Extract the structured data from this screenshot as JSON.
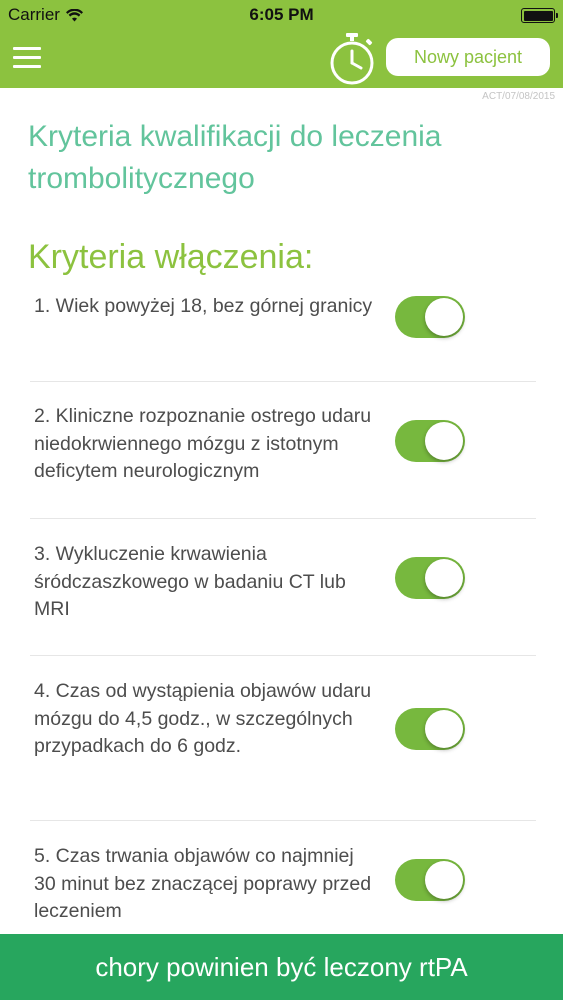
{
  "status_bar": {
    "carrier": "Carrier",
    "time": "6:05 PM",
    "icons": [
      "wifi-icon",
      "battery-icon"
    ]
  },
  "nav": {
    "menu_icon": "hamburger-menu-icon",
    "timer_icon": "stopwatch-icon",
    "new_patient_label": "Nowy pacjent"
  },
  "version_label": "ACT/07/08/2015",
  "page_title": "Kryteria kwalifikacji do leczenia trombolitycznego",
  "section_title": "Kryteria włączenia:",
  "criteria": [
    {
      "text": "1. Wiek powyżej 18, bez górnej granicy",
      "enabled": true
    },
    {
      "text": "2. Kliniczne rozpoznanie ostrego udaru niedokrwiennego mózgu z istotnym deficytem neurologicznym",
      "enabled": true
    },
    {
      "text": "3. Wykluczenie krwawienia śródczaszkowego w badaniu CT lub MRI",
      "enabled": true
    },
    {
      "text": "4. Czas od wystąpienia objawów udaru mózgu do 4,5 godz., w szczególnych przypadkach do 6 godz.",
      "enabled": true
    },
    {
      "text": "5. Czas trwania objawów co najmniej 30 minut bez znaczącej poprawy przed leczeniem",
      "enabled": true
    }
  ],
  "footer_label": "chory powinien być leczony rtPA",
  "colors": {
    "nav_green": "#8cc23f",
    "title_teal": "#62c49c",
    "toggle_green": "#77b83e",
    "footer_green": "#27a65e"
  }
}
